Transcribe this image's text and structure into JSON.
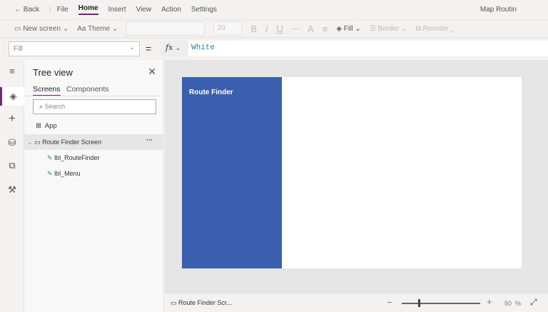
{
  "menu": {
    "back": "Back",
    "items": [
      "File",
      "Home",
      "Insert",
      "View",
      "Action",
      "Settings"
    ],
    "app_title": "Map Routin"
  },
  "toolbar": {
    "new_screen": "New screen",
    "theme": "Theme",
    "font_size": "20",
    "bold": "B",
    "italic": "/",
    "underline": "U",
    "strike": "—",
    "font_color": "A",
    "align": "≡",
    "fill": "Fill",
    "border": "Border",
    "reorder": "Reorder"
  },
  "formula": {
    "property": "Fill",
    "equals": "=",
    "fx": "fx",
    "value": "White"
  },
  "tree": {
    "title": "Tree view",
    "tabs": [
      "Screens",
      "Components"
    ],
    "search_placeholder": "Search",
    "app": "App",
    "screen": "Route Finder Screen",
    "more": "···",
    "children": [
      "lbl_RouteFinder",
      "lbl_Menu"
    ]
  },
  "canvas": {
    "label": "Route Finder",
    "panel_color": "#3a5fae"
  },
  "status": {
    "screen": "Route Finder Scr...",
    "zoom_minus": "−",
    "zoom_plus": "+",
    "zoom_value": "50",
    "zoom_unit": "%",
    "zoom_percent": 50
  }
}
